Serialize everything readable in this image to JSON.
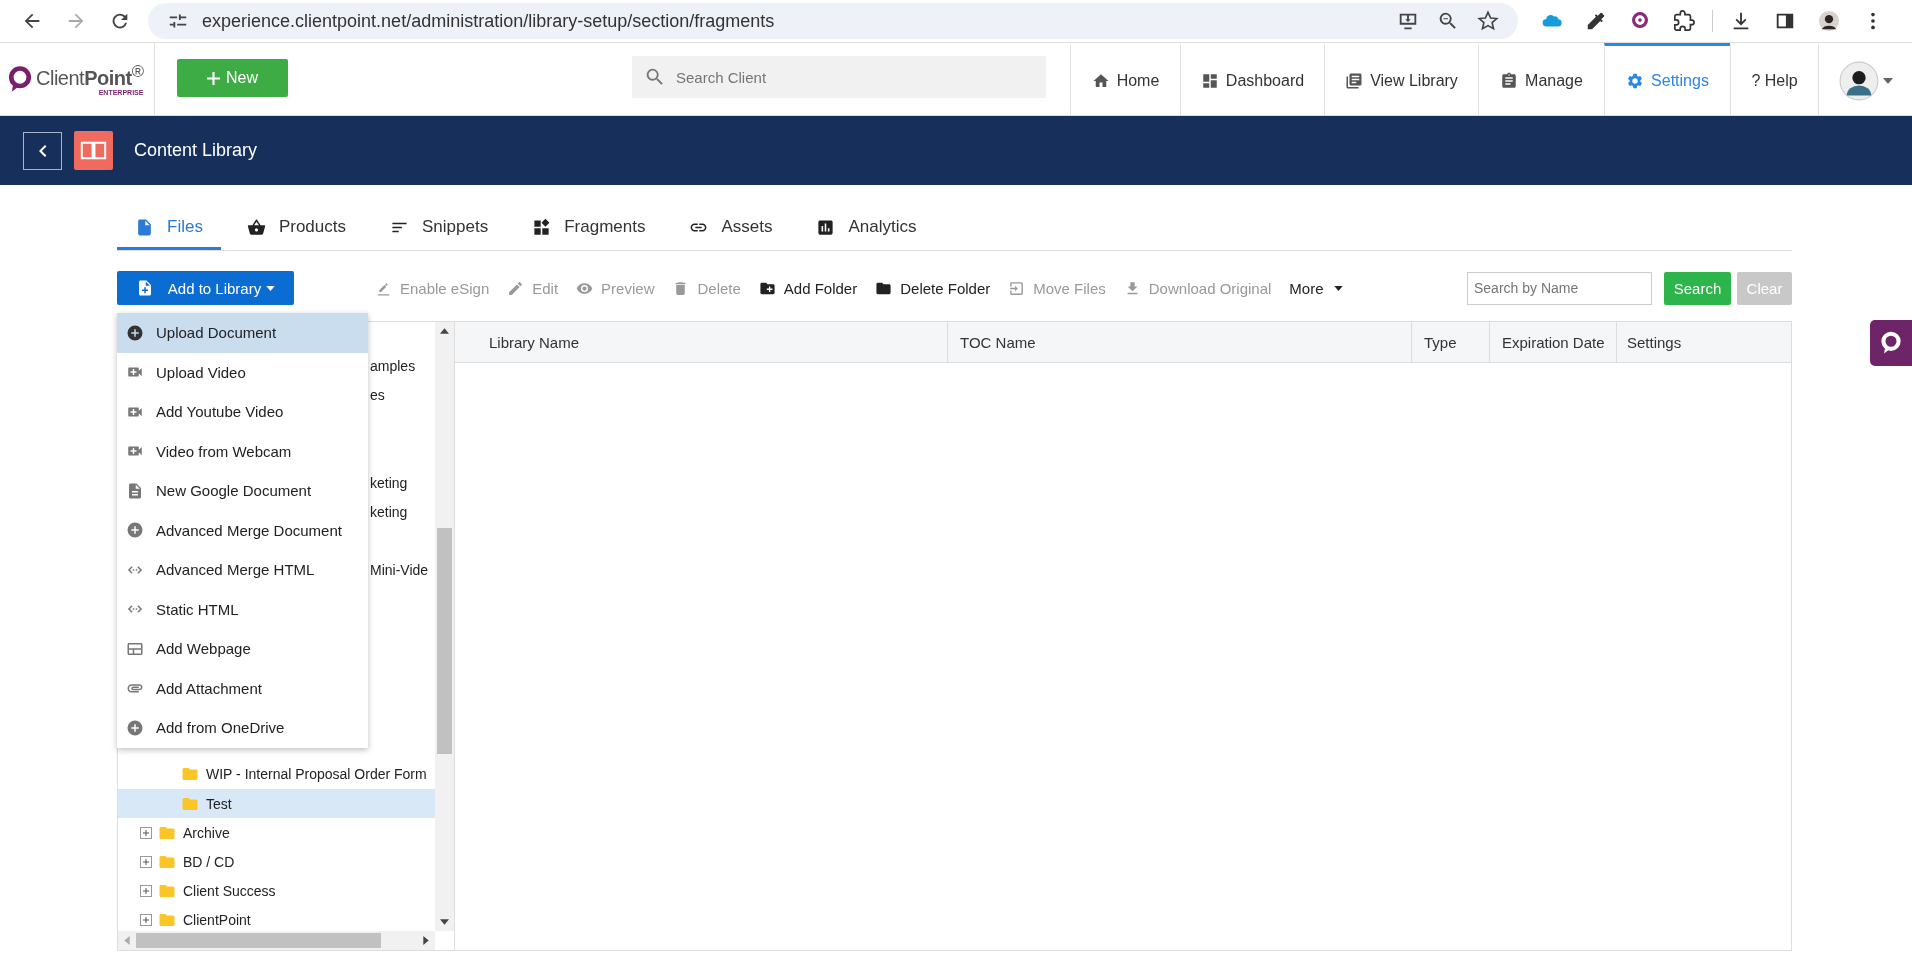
{
  "browser": {
    "url": "experience.clientpoint.net/administration/library-setup/section/fragments"
  },
  "app_nav": {
    "logo": {
      "name": "Client**Point**$^{®}$",
      "edition": "ENTERPRISE"
    },
    "new_button": "New",
    "search": {
      "placeholder": "Search Client"
    },
    "items": [
      {
        "kind": "home",
        "label": "Home",
        "selected": false
      },
      {
        "kind": "dashboard",
        "label": "Dashboard",
        "selected": false
      },
      {
        "kind": "library",
        "label": "View Library",
        "selected": false
      },
      {
        "kind": "manage",
        "label": "Manage",
        "selected": false
      },
      {
        "kind": "settings",
        "label": "Settings",
        "selected": true
      },
      {
        "kind": "help",
        "label": "? Help",
        "selected": false
      }
    ]
  },
  "header": {
    "title": "Content Library"
  },
  "tabs": [
    {
      "kind": "files",
      "label": "Files",
      "selected": true
    },
    {
      "kind": "products",
      "label": "Products",
      "selected": false
    },
    {
      "kind": "snippets",
      "label": "Snippets",
      "selected": false
    },
    {
      "kind": "fragments",
      "label": "Fragments",
      "selected": false
    },
    {
      "kind": "assets",
      "label": "Assets",
      "selected": false
    },
    {
      "kind": "analytics",
      "label": "Analytics",
      "selected": false
    }
  ],
  "toolbar": {
    "add_button": "Add to Library",
    "tools": [
      {
        "kind": "esign",
        "label": "Enable eSign",
        "disabled": true
      },
      {
        "kind": "edit",
        "label": "Edit",
        "disabled": true
      },
      {
        "kind": "preview",
        "label": "Preview",
        "disabled": true
      },
      {
        "kind": "delete",
        "label": "Delete",
        "disabled": true
      },
      {
        "kind": "add-folder",
        "label": "Add Folder",
        "disabled": false
      },
      {
        "kind": "delete-folder",
        "label": "Delete Folder",
        "disabled": false
      },
      {
        "kind": "move",
        "label": "Move Files",
        "disabled": true
      },
      {
        "kind": "download",
        "label": "Download Original",
        "disabled": true
      }
    ],
    "more": "More",
    "search": {
      "placeholder": "Search by Name"
    },
    "search_button": "Search",
    "clear_button": {
      "label": "Clear",
      "disabled": true
    }
  },
  "add_menu": [
    {
      "kind": "upload",
      "label": "Upload Document",
      "selected": true
    },
    {
      "kind": "video",
      "label": "Upload Video",
      "selected": false
    },
    {
      "kind": "video",
      "label": "Add Youtube Video",
      "selected": false
    },
    {
      "kind": "video",
      "label": "Video from Webcam",
      "selected": false
    },
    {
      "kind": "doc",
      "label": "New Google Document",
      "selected": false
    },
    {
      "kind": "merge",
      "label": "Advanced Merge Document",
      "selected": false
    },
    {
      "kind": "html",
      "label": "Advanced Merge HTML",
      "selected": false
    },
    {
      "kind": "html",
      "label": "Static HTML",
      "selected": false
    },
    {
      "kind": "webpage",
      "label": "Add Webpage",
      "selected": false
    },
    {
      "kind": "attachment",
      "label": "Add Attachment",
      "selected": false
    },
    {
      "kind": "merge",
      "label": "Add from OneDrive",
      "selected": false
    }
  ],
  "tree": [
    {
      "children": [
        {
          "kind": "covered"
        },
        {
          "kind": "covered",
          "label": "amples"
        },
        {
          "kind": "covered",
          "label": "es"
        },
        {
          "kind": "covered"
        },
        {
          "kind": "covered"
        },
        {
          "kind": "covered",
          "label": "keting"
        },
        {
          "kind": "covered",
          "label": "keting"
        },
        {
          "kind": "covered"
        },
        {
          "kind": "covered",
          "label": "Mini-Vide"
        },
        {
          "kind": "covered"
        },
        {
          "kind": "covered"
        },
        {
          "kind": "covered"
        },
        {
          "kind": "covered"
        },
        {
          "kind": "covered"
        },
        {
          "kind": "covered"
        },
        {
          "kind": "folder",
          "label": "WIP - Internal Proposal Order Form",
          "selected": false
        },
        {
          "kind": "folder",
          "label": "Test",
          "selected": true
        }
      ]
    },
    {
      "label": "Archive",
      "expanded": false,
      "selected": false
    },
    {
      "label": "BD / CD",
      "expanded": false,
      "selected": false
    },
    {
      "label": "Client Success",
      "expanded": false,
      "selected": false
    },
    {
      "label": "ClientPoint",
      "expanded": false,
      "selected": false
    }
  ],
  "table": {
    "columns": [
      "Library Name",
      "TOC Name",
      "Type",
      "Expiration Date",
      "Settings"
    ]
  }
}
